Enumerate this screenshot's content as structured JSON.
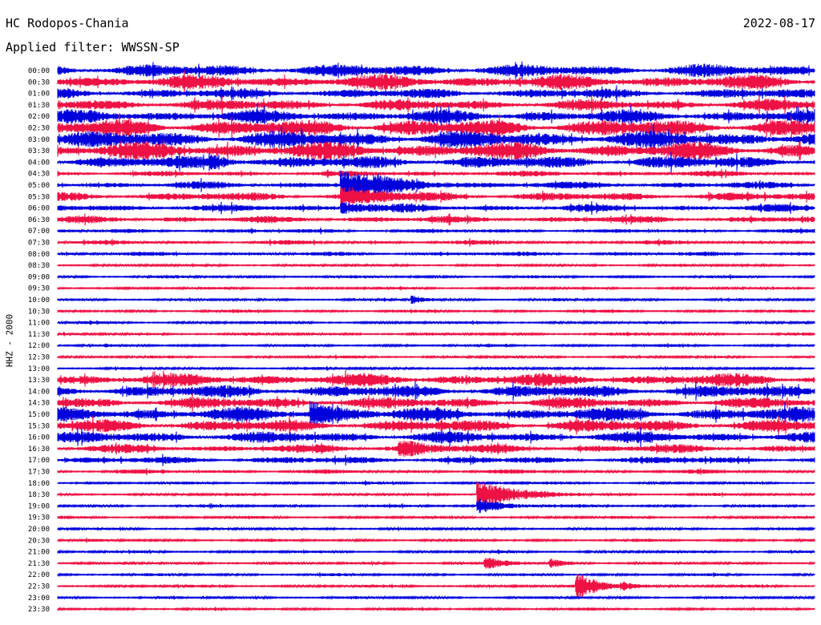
{
  "header": {
    "station": "HC Rodopos-Chania",
    "date": "2022-08-17",
    "filter": "Applied filter: WWSSN-SP"
  },
  "channel_label": "HHZ - 2000",
  "colors": {
    "odd_rows": "#0000dd",
    "even_rows": "#ee1144"
  },
  "chart_data": {
    "type": "line",
    "title": "HC Rodopos-Chania",
    "subtitle": "Applied filter: WWSSN-SP",
    "ylabel": "HHZ - 2000",
    "xlabel": "",
    "grid": false,
    "legend": "none",
    "series_colors": [
      "#0000dd",
      "#ee1144"
    ],
    "row_labels": [
      "00:00",
      "00:30",
      "01:00",
      "01:30",
      "02:00",
      "02:30",
      "03:00",
      "03:30",
      "04:00",
      "04:30",
      "05:00",
      "05:30",
      "06:00",
      "06:30",
      "07:00",
      "07:30",
      "08:00",
      "08:30",
      "09:00",
      "09:30",
      "10:00",
      "10:30",
      "11:00",
      "11:30",
      "12:00",
      "12:30",
      "13:00",
      "13:30",
      "14:00",
      "14:30",
      "15:00",
      "15:30",
      "16:00",
      "16:30",
      "17:00",
      "17:30",
      "18:00",
      "18:30",
      "19:00",
      "19:30",
      "20:00",
      "20:30",
      "21:00",
      "21:30",
      "22:00",
      "22:30",
      "23:00",
      "23:30"
    ],
    "noise_amplitude": [
      9,
      10,
      7,
      8,
      9,
      12,
      12,
      12,
      9,
      4,
      5,
      6,
      5,
      5,
      3,
      3,
      3,
      2,
      2,
      2,
      2,
      2,
      2,
      2,
      2,
      2,
      2,
      9,
      9,
      8,
      10,
      9,
      8,
      6,
      5,
      3,
      2,
      2,
      2,
      2,
      2,
      2,
      2,
      2,
      2,
      2,
      2,
      2
    ],
    "events": [
      {
        "row": 10,
        "minute": 11.2,
        "amplitude": 18,
        "duration_min": 1.8
      },
      {
        "row": 11,
        "minute": 11.2,
        "amplitude": 10,
        "duration_min": 1.5
      },
      {
        "row": 12,
        "minute": 11.2,
        "amplitude": 8,
        "duration_min": 1.2
      },
      {
        "row": 8,
        "minute": 6.0,
        "amplitude": 7,
        "duration_min": 0.8
      },
      {
        "row": 20,
        "minute": 14.0,
        "amplitude": 6,
        "duration_min": 0.4
      },
      {
        "row": 30,
        "minute": 10.0,
        "amplitude": 14,
        "duration_min": 0.9
      },
      {
        "row": 33,
        "minute": 13.5,
        "amplitude": 11,
        "duration_min": 1.0
      },
      {
        "row": 37,
        "minute": 16.6,
        "amplitude": 18,
        "duration_min": 1.4
      },
      {
        "row": 38,
        "minute": 16.6,
        "amplitude": 10,
        "duration_min": 1.0
      },
      {
        "row": 43,
        "minute": 16.9,
        "amplitude": 8,
        "duration_min": 0.7
      },
      {
        "row": 43,
        "minute": 19.5,
        "amplitude": 5,
        "duration_min": 0.6
      },
      {
        "row": 45,
        "minute": 20.5,
        "amplitude": 16,
        "duration_min": 1.0
      },
      {
        "row": 45,
        "minute": 22.3,
        "amplitude": 5,
        "duration_min": 0.5
      }
    ]
  }
}
